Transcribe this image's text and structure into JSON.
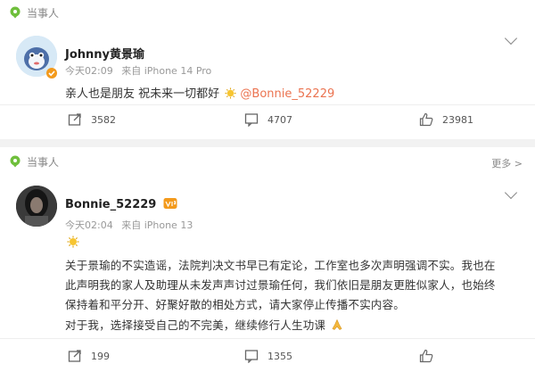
{
  "post1": {
    "section_label": "当事人",
    "author": "Johnny黄景瑜",
    "time": "今天02:09",
    "source": "来自 iPhone 14 Pro",
    "text": "亲人也是朋友 祝未来一切都好",
    "mention": "@Bonnie_52229",
    "repost_count": "3582",
    "comment_count": "4707",
    "like_count": "23981"
  },
  "post2": {
    "section_label": "当事人",
    "more_label": "更多 >",
    "author": "Bonnie_52229",
    "time": "今天02:04",
    "source": "来自 iPhone 13",
    "lines": [
      "关于景瑜的不实造谣，法院判决文书早已有定论，工作室也多次声明强调不实。我也在",
      "此声明我的家人及助理从未发声声讨过景瑜任何，我们依旧是朋友更胜似家人，也始终",
      "保持着和平分开、好聚好散的相处方式，请大家停止传播不实内容。",
      "对于我，选择接受自己的不完美，继续修行人生功课"
    ],
    "repost_count": "199",
    "comment_count": "1355"
  },
  "colors": {
    "accent": "#eb7350",
    "green": "#6fbf3c",
    "badge_orange": "#f39a1c"
  },
  "icons": [
    "location-pin-icon",
    "chevron-down-icon",
    "repost-icon",
    "comment-icon",
    "like-icon",
    "sun-emoji-icon",
    "folded-hands-emoji-icon",
    "verified-badge-icon",
    "vip-badge-icon"
  ]
}
